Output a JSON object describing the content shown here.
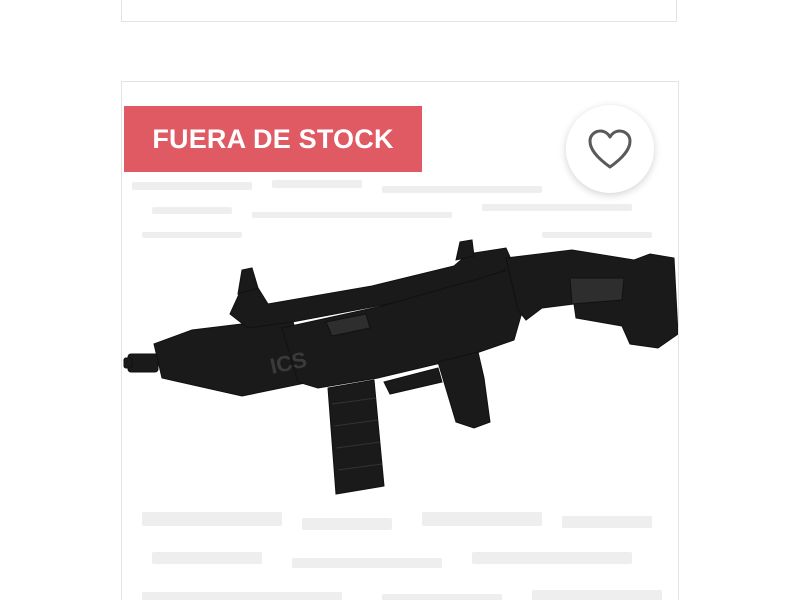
{
  "product_card": {
    "badge_label": "FUERA DE STOCK",
    "badge_color": "#e05a63",
    "wishlist_icon": "heart-outline-icon",
    "image_subject": "black airsoft rifle with folding stock"
  }
}
